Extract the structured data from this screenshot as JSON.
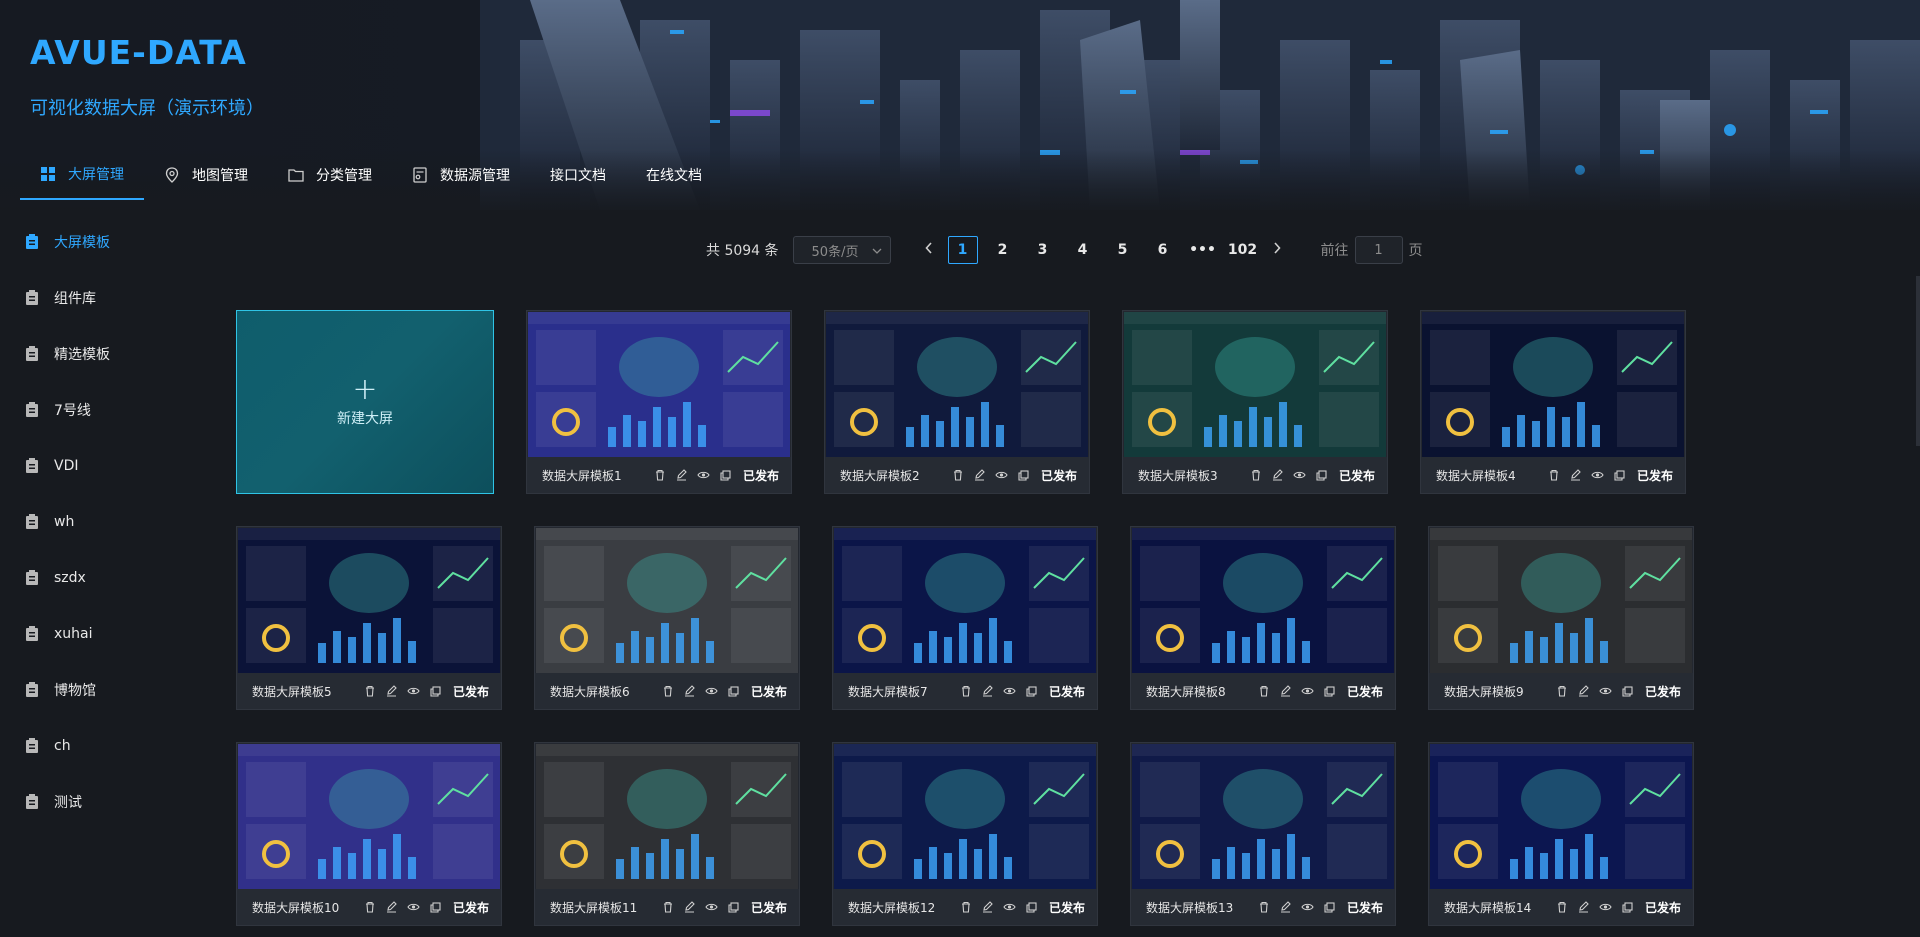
{
  "brand": {
    "title": "AVUE-DATA",
    "subtitle": "可视化数据大屏（演示环境）"
  },
  "topnav": [
    {
      "label": "大屏管理",
      "icon": "grid-icon",
      "active": true
    },
    {
      "label": "地图管理",
      "icon": "location-pin-icon"
    },
    {
      "label": "分类管理",
      "icon": "folder-icon"
    },
    {
      "label": "数据源管理",
      "icon": "database-icon"
    },
    {
      "label": "接口文档",
      "icon": ""
    },
    {
      "label": "在线文档",
      "icon": ""
    }
  ],
  "sidebar": [
    {
      "label": "大屏模板",
      "active": true
    },
    {
      "label": "组件库"
    },
    {
      "label": "精选模板"
    },
    {
      "label": "7号线"
    },
    {
      "label": "VDI"
    },
    {
      "label": "wh"
    },
    {
      "label": "szdx"
    },
    {
      "label": "xuhai"
    },
    {
      "label": "博物馆"
    },
    {
      "label": "ch"
    },
    {
      "label": "测试"
    }
  ],
  "pager": {
    "total": "共 5094 条",
    "page_size": "50条/页",
    "pages": [
      "1",
      "2",
      "3",
      "4",
      "5",
      "6",
      "•••",
      "102"
    ],
    "current": "1",
    "jump_prefix": "前往",
    "jump_value": "1",
    "jump_suffix": "页"
  },
  "new_card": {
    "plus": "+",
    "label": "新建大屏"
  },
  "cards": [
    {
      "name": "数据大屏模板1",
      "status": "已发布",
      "theme": "#2a2f8c"
    },
    {
      "name": "数据大屏模板2",
      "status": "已发布",
      "theme": "#101a3c"
    },
    {
      "name": "数据大屏模板3",
      "status": "已发布",
      "theme": "#133a3a"
    },
    {
      "name": "数据大屏模板4",
      "status": "已发布",
      "theme": "#0a1230"
    },
    {
      "name": "数据大屏模板5",
      "status": "已发布",
      "theme": "#0b1338"
    },
    {
      "name": "数据大屏模板6",
      "status": "已发布",
      "theme": "#3a3d42"
    },
    {
      "name": "数据大屏模板7",
      "status": "已发布",
      "theme": "#0b1548"
    },
    {
      "name": "数据大屏模板8",
      "status": "已发布",
      "theme": "#0a1240"
    },
    {
      "name": "数据大屏模板9",
      "status": "已发布",
      "theme": "#2b2d30"
    },
    {
      "name": "数据大屏模板10",
      "status": "已发布",
      "theme": "#31308a"
    },
    {
      "name": "数据大屏模板11",
      "status": "已发布",
      "theme": "#2e3034"
    },
    {
      "name": "数据大屏模板12",
      "status": "已发布",
      "theme": "#0d1a4a"
    },
    {
      "name": "数据大屏模板13",
      "status": "已发布",
      "theme": "#101a48"
    },
    {
      "name": "数据大屏模板14",
      "status": "已发布",
      "theme": "#0c1650"
    }
  ],
  "colors": {
    "accent": "#2fa8ff",
    "background": "#171a1f",
    "new_card": "#12606e"
  }
}
